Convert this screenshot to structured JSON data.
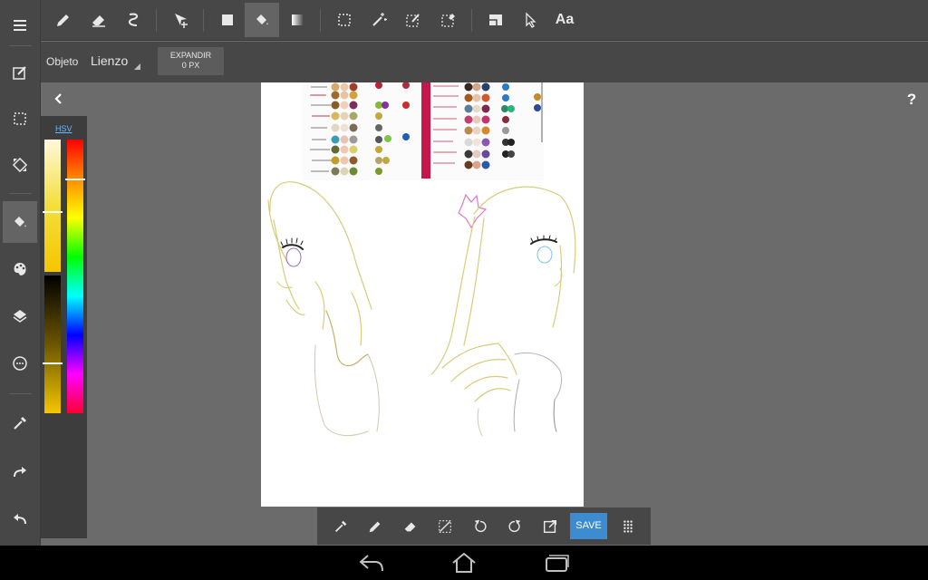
{
  "object_bar": {
    "label": "Objeto",
    "selected": "Lienzo",
    "expand_button": "EXPANDIR",
    "expand_value": "0 PX"
  },
  "top_tools": [
    "pen-icon",
    "eraser-icon",
    "smudge-icon",
    "move-icon",
    "fill-rect-icon",
    "bucket-icon",
    "gradient-icon",
    "select-rect-icon",
    "magic-wand-icon",
    "select-pen-icon",
    "select-eraser-icon",
    "shape-icon",
    "pointer-icon",
    "text-icon"
  ],
  "text_tool_label": "Aa",
  "left_tools": [
    "menu-icon",
    "edit-icon",
    "selection-icon",
    "transform-icon",
    "bucket-icon",
    "palette-icon",
    "layers-icon",
    "grid-icon",
    "eyedropper-icon",
    "redo-icon",
    "undo-icon"
  ],
  "color_panel": {
    "mode_label": "HSV",
    "current_color": "#f4c600"
  },
  "help_label": "?",
  "bottom_tools": [
    "eyedropper-icon",
    "pen-icon",
    "eraser-icon",
    "deselect-icon",
    "rotate-left-icon",
    "rotate-right-icon",
    "expand-icon"
  ],
  "save_label": "SAVE",
  "nav": [
    "back-icon",
    "home-icon",
    "recents-icon"
  ]
}
